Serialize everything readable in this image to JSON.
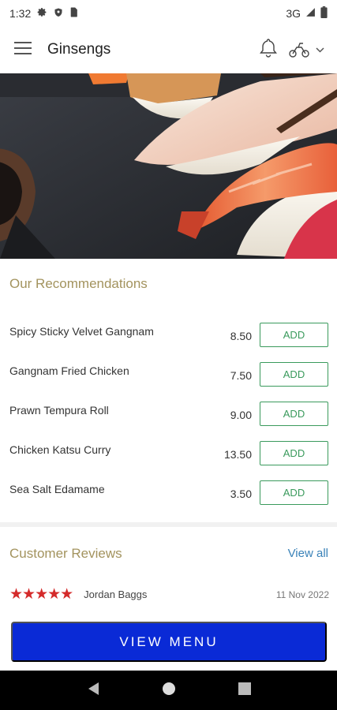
{
  "status_bar": {
    "time": "1:32",
    "network": "3G"
  },
  "app_bar": {
    "title": "Ginsengs"
  },
  "recommendations": {
    "title": "Our Recommendations",
    "items": [
      {
        "name": "Spicy Sticky Velvet Gangnam",
        "price": "8.50",
        "button": "ADD"
      },
      {
        "name": "Gangnam Fried Chicken",
        "price": "7.50",
        "button": "ADD"
      },
      {
        "name": "Prawn Tempura Roll",
        "price": "9.00",
        "button": "ADD"
      },
      {
        "name": "Chicken Katsu Curry",
        "price": "13.50",
        "button": "ADD"
      },
      {
        "name": "Sea Salt Edamame",
        "price": "3.50",
        "button": "ADD"
      }
    ]
  },
  "reviews": {
    "title": "Customer Reviews",
    "view_all": "View all",
    "items": [
      {
        "rating": 5,
        "stars": "★★★★★",
        "reviewer": "Jordan Baggs",
        "date": "11 Nov 2022"
      }
    ]
  },
  "cta": {
    "label": "VIEW MENU"
  },
  "colors": {
    "accent_gold": "#a3935e",
    "add_green": "#3a9a5c",
    "cta_blue": "#0a2ad6",
    "star_red": "#d42a2a",
    "link_blue": "#3a82b8"
  },
  "icons": {
    "status": [
      "settings-icon",
      "shield-icon",
      "sim-icon",
      "signal-icon",
      "battery-icon"
    ],
    "app_bar": [
      "menu-icon",
      "bell-icon",
      "scooter-icon",
      "chevron-down-icon"
    ],
    "nav": [
      "back-icon",
      "home-icon",
      "recents-icon"
    ]
  }
}
